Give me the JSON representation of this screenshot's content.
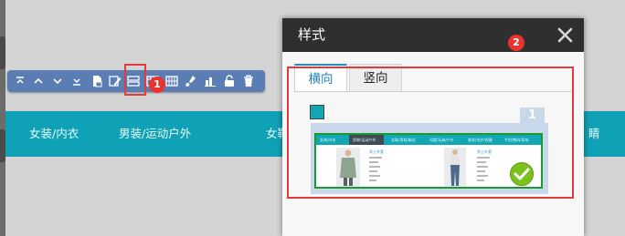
{
  "toolbar": {
    "buttons": [
      {
        "name": "move-top",
        "icon": "arrow-up-to-line-icon"
      },
      {
        "name": "move-up",
        "icon": "chevron-up-icon"
      },
      {
        "name": "move-down",
        "icon": "chevron-down-icon"
      },
      {
        "name": "move-bottom",
        "icon": "arrow-down-to-line-icon"
      },
      {
        "name": "template",
        "icon": "document-icon"
      },
      {
        "name": "edit",
        "icon": "pencil-icon"
      },
      {
        "name": "style",
        "icon": "layout-rows-icon"
      },
      {
        "name": "table",
        "icon": "table-icon"
      },
      {
        "name": "columns",
        "icon": "columns-icon"
      },
      {
        "name": "color",
        "icon": "brush-icon"
      },
      {
        "name": "chart",
        "icon": "bar-chart-icon"
      },
      {
        "name": "lock",
        "icon": "unlock-icon"
      },
      {
        "name": "delete",
        "icon": "trash-icon"
      }
    ]
  },
  "annotations": {
    "badge1": "1",
    "badge2": "2"
  },
  "navbar": {
    "items": [
      "女装/内衣",
      "男装/运动户外",
      "女鞋",
      "睛"
    ]
  },
  "dialog": {
    "title": "样式",
    "tabs": [
      {
        "label": "横向",
        "active": true
      },
      {
        "label": "竖向",
        "active": false
      }
    ],
    "swatch_color": "#13a6b4",
    "thumbnail": {
      "number": "1",
      "nav": [
        "女装/内衣",
        "男装/运动户外",
        "女鞋/男鞋/箱包",
        "母婴/玩具/户外",
        "美妆/洗护/保健",
        "手机/数码/家电"
      ],
      "category": "男士外套"
    }
  },
  "colors": {
    "accent": "#0fa1b5",
    "toolbar": "#5a7db3",
    "highlight": "#e23b3b",
    "active_tab": "#1f8fc7",
    "check": "#7dc11e"
  }
}
